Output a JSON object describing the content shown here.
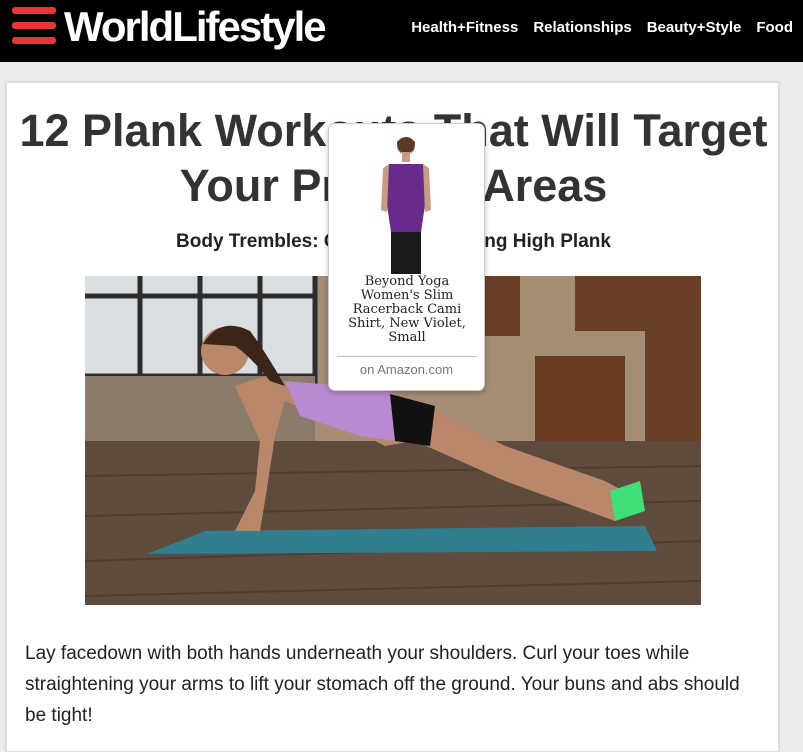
{
  "header": {
    "logo": "WorldLifestyle",
    "nav": [
      "Health+Fitness",
      "Relationships",
      "Beauty+Style",
      "Food"
    ]
  },
  "article": {
    "title": "12 Plank Workouts That Will Target Your Problem Areas",
    "subtitle": "Body Trembles: Getting Into Starting High Plank",
    "body": "Lay facedown with both hands underneath your shoulders. Curl your toes while straightening your arms to lift your stomach off the ground. Your buns and abs should be tight!"
  },
  "popup": {
    "product_title": "Beyond Yoga Women's Slim Racerback Cami Shirt, New Violet, Small",
    "source": "on Amazon.com"
  },
  "colors": {
    "brand_red": "#e53935",
    "header_bg": "#000000",
    "cami_purple": "#6a2a8c"
  }
}
